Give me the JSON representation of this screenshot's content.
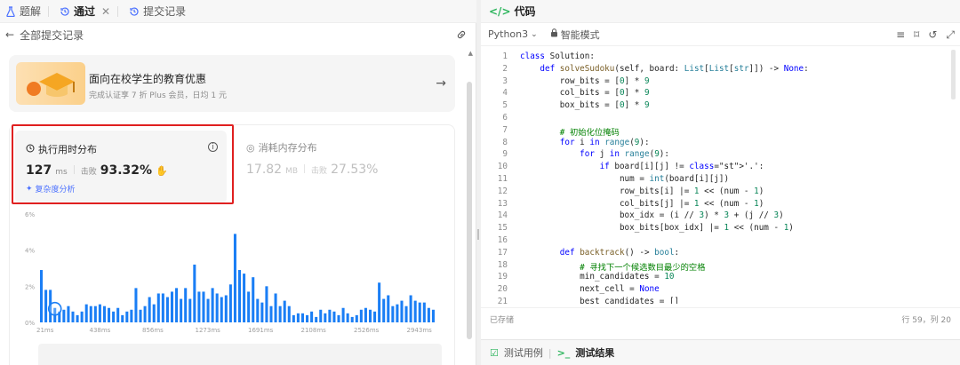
{
  "left_tabs": [
    {
      "label": "题解"
    },
    {
      "label": "通过"
    },
    {
      "label": "提交记录"
    }
  ],
  "subbar": {
    "back_label": "全部提交记录"
  },
  "promo": {
    "title": "面向在校学生的教育优惠",
    "subtitle": "完成认证享 7 折 Plus 会员，日均 1 元"
  },
  "runtime": {
    "title": "执行用时分布",
    "value": "127",
    "unit": "ms",
    "beat_label": "击败",
    "beat_value": "93.32%",
    "complexity_label": "复杂度分析"
  },
  "memory": {
    "title": "消耗内存分布",
    "value": "17.82",
    "unit": "MB",
    "beat_label": "击败",
    "beat_value": "27.53%"
  },
  "chart_data": {
    "type": "bar",
    "y_ticks": [
      "6%",
      "4%",
      "2%",
      "0%"
    ],
    "x_ticks": [
      "21ms",
      "438ms",
      "856ms",
      "1273ms",
      "1691ms",
      "2108ms",
      "2526ms",
      "2943ms"
    ],
    "ylim": [
      0,
      6
    ],
    "highlight_index": 3,
    "values": [
      2.9,
      1.8,
      1.8,
      0.8,
      0.6,
      0.7,
      0.9,
      0.6,
      0.4,
      0.6,
      1.0,
      0.9,
      0.9,
      1.0,
      0.9,
      0.8,
      0.6,
      0.8,
      0.4,
      0.6,
      0.7,
      1.9,
      0.7,
      0.9,
      1.4,
      1.0,
      1.6,
      1.6,
      1.4,
      1.7,
      1.9,
      1.3,
      1.9,
      1.3,
      3.2,
      1.7,
      1.7,
      1.3,
      1.9,
      1.6,
      1.4,
      1.5,
      2.1,
      4.9,
      2.9,
      2.7,
      1.7,
      2.5,
      1.3,
      1.1,
      2.0,
      0.9,
      1.6,
      0.9,
      1.2,
      0.9,
      0.4,
      0.5,
      0.5,
      0.4,
      0.6,
      0.3,
      0.7,
      0.5,
      0.7,
      0.6,
      0.4,
      0.8,
      0.5,
      0.3,
      0.4,
      0.7,
      0.8,
      0.7,
      0.6,
      2.2,
      1.3,
      1.5,
      0.9,
      1.0,
      1.2,
      0.9,
      1.5,
      1.2,
      1.1,
      1.1,
      0.8,
      0.7
    ],
    "colors": {
      "bar": "#1a7ef5",
      "highlight": "#1a7ef5"
    }
  },
  "right": {
    "tab_label": "代码",
    "language": "Python3",
    "mode": "智能模式",
    "status_left": "已存储",
    "status_right": "行 59，列 20",
    "bottom_tab1": "测试用例",
    "bottom_tab2": "测试结果"
  },
  "code_lines": [
    {
      "n": "1",
      "t": "class Solution:"
    },
    {
      "n": "2",
      "t": "    def solveSudoku(self, board: List[List[str]]) -> None:"
    },
    {
      "n": "3",
      "t": "        row_bits = [0] * 9"
    },
    {
      "n": "4",
      "t": "        col_bits = [0] * 9"
    },
    {
      "n": "5",
      "t": "        box_bits = [0] * 9"
    },
    {
      "n": "6",
      "t": ""
    },
    {
      "n": "7",
      "t": "        # 初始化位掩码"
    },
    {
      "n": "8",
      "t": "        for i in range(9):"
    },
    {
      "n": "9",
      "t": "            for j in range(9):"
    },
    {
      "n": "10",
      "t": "                if board[i][j] != '.':"
    },
    {
      "n": "11",
      "t": "                    num = int(board[i][j])"
    },
    {
      "n": "12",
      "t": "                    row_bits[i] |= 1 << (num - 1)"
    },
    {
      "n": "13",
      "t": "                    col_bits[j] |= 1 << (num - 1)"
    },
    {
      "n": "14",
      "t": "                    box_idx = (i // 3) * 3 + (j // 3)"
    },
    {
      "n": "15",
      "t": "                    box_bits[box_idx] |= 1 << (num - 1)"
    },
    {
      "n": "16",
      "t": ""
    },
    {
      "n": "17",
      "t": "        def backtrack() -> bool:"
    },
    {
      "n": "18",
      "t": "            # 寻找下一个候选数目最少的空格"
    },
    {
      "n": "19",
      "t": "            min_candidates = 10"
    },
    {
      "n": "20",
      "t": "            next_cell = None"
    },
    {
      "n": "21",
      "t": "            best_candidates = []"
    }
  ]
}
